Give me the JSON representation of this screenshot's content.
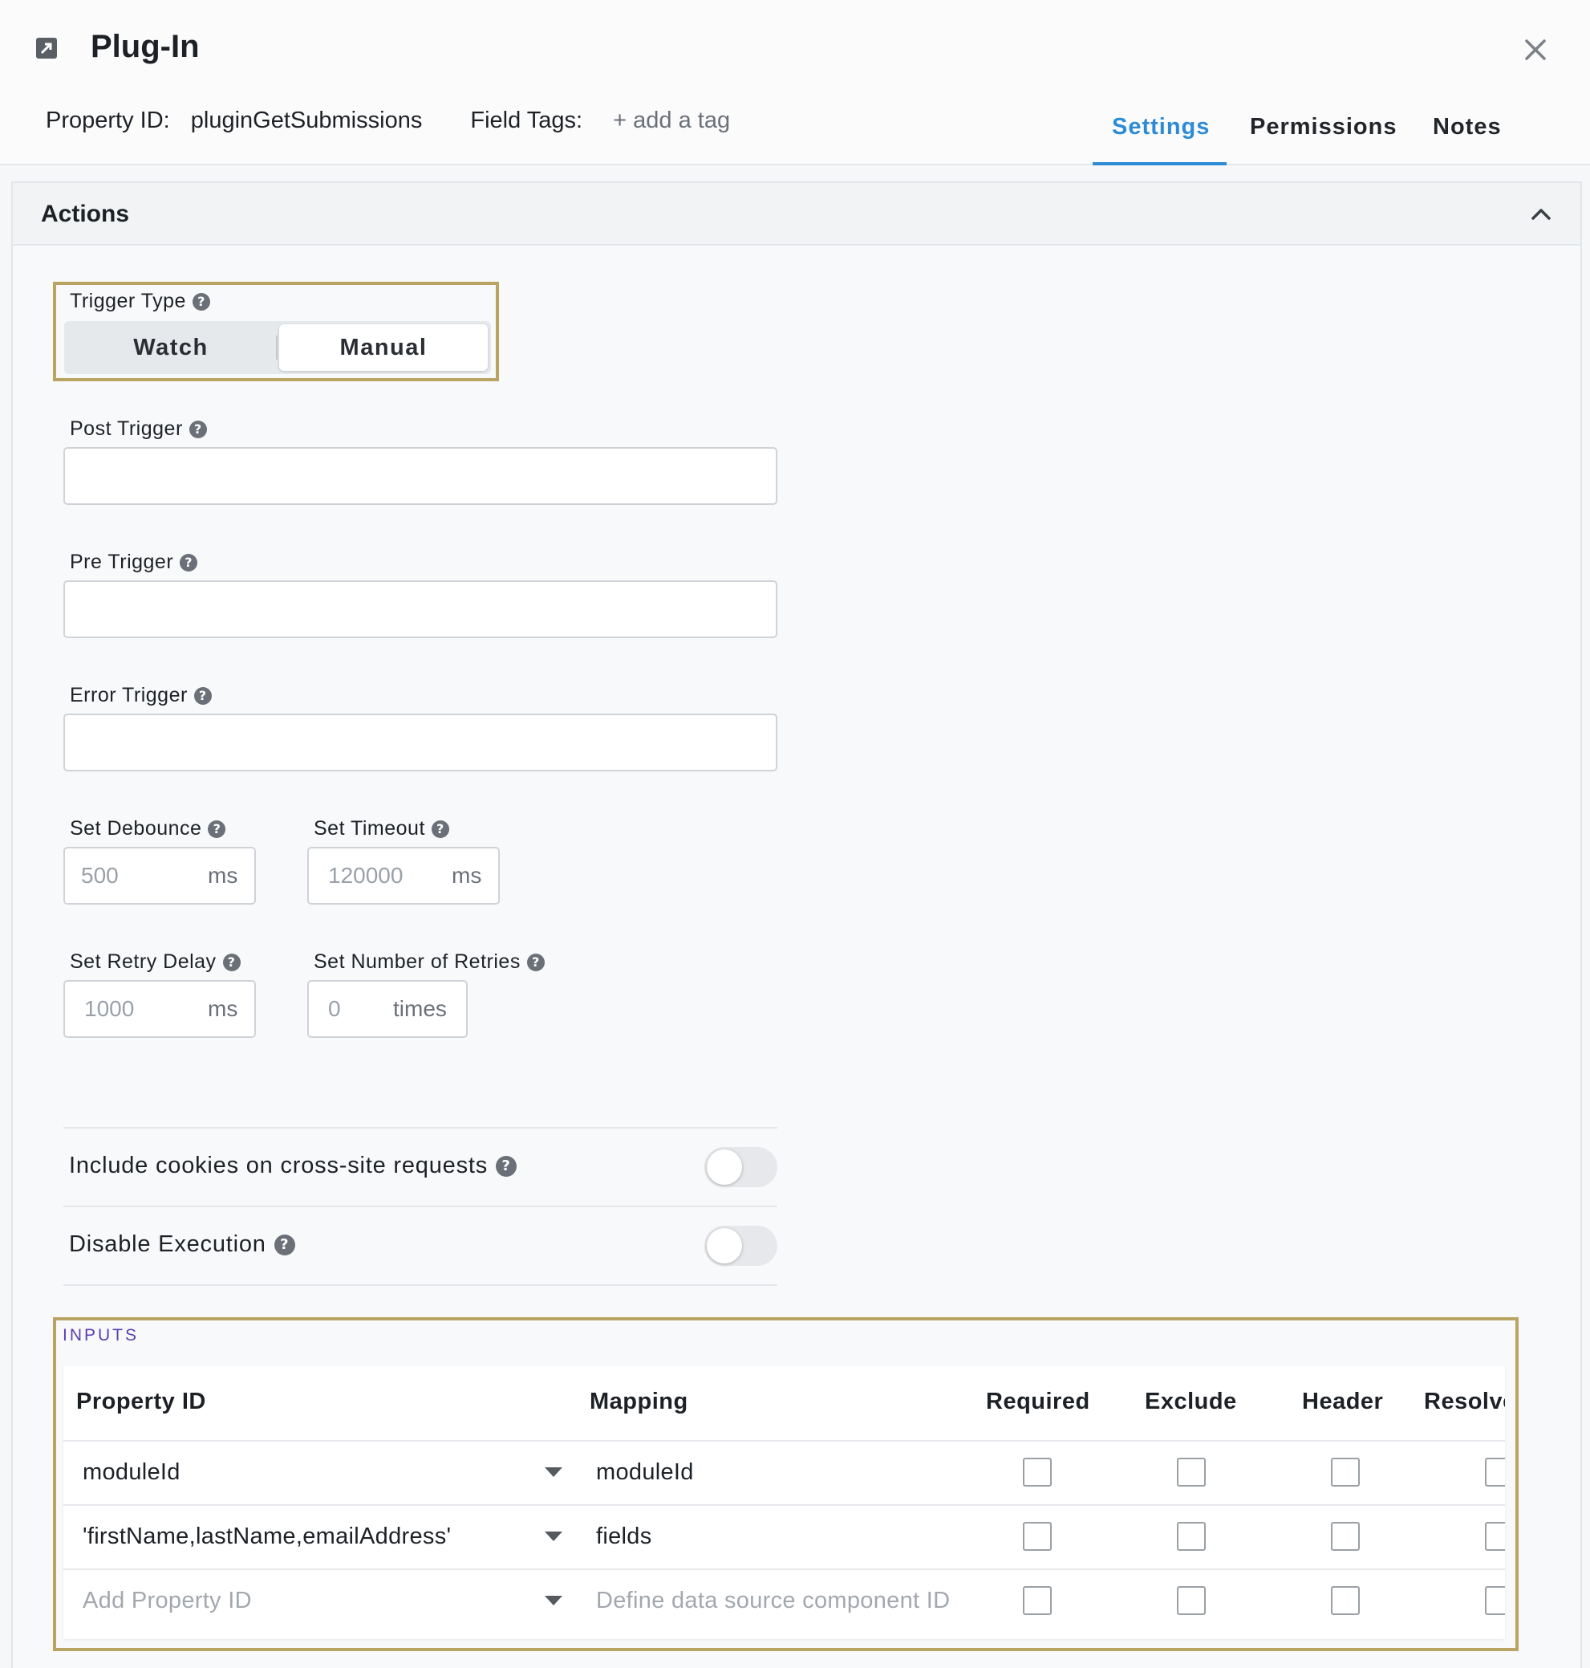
{
  "header": {
    "title": "Plug-In",
    "property_id_label": "Property ID:",
    "property_id_value": "pluginGetSubmissions",
    "field_tags_label": "Field Tags:",
    "add_tag": "+ add a tag",
    "tabs": [
      {
        "label": "Settings",
        "active": true
      },
      {
        "label": "Permissions",
        "active": false
      },
      {
        "label": "Notes",
        "active": false
      }
    ]
  },
  "actions": {
    "title": "Actions",
    "trigger_type": {
      "label": "Trigger Type",
      "options": [
        "Watch",
        "Manual"
      ],
      "selected": "Manual"
    },
    "post_trigger": {
      "label": "Post Trigger",
      "value": ""
    },
    "pre_trigger": {
      "label": "Pre Trigger",
      "value": ""
    },
    "error_trigger": {
      "label": "Error Trigger",
      "value": ""
    },
    "debounce": {
      "label": "Set Debounce",
      "placeholder": "500",
      "unit": "ms"
    },
    "timeout": {
      "label": "Set Timeout",
      "placeholder": "120000",
      "unit": "ms"
    },
    "retry_delay": {
      "label": "Set Retry Delay",
      "placeholder": "1000",
      "unit": "ms"
    },
    "retries": {
      "label": "Set Number of Retries",
      "placeholder": "0",
      "unit": "times"
    },
    "include_cookies": {
      "label": "Include cookies on cross-site requests",
      "on": false
    },
    "disable_execution": {
      "label": "Disable Execution",
      "on": false
    }
  },
  "inputs": {
    "title": "INPUTS",
    "columns": [
      "Property ID",
      "Mapping",
      "Required",
      "Exclude",
      "Header",
      "Resolve"
    ],
    "rows": [
      {
        "property_id": "moduleId",
        "mapping": "moduleId"
      },
      {
        "property_id": "'firstName,lastName,emailAddress'",
        "mapping": "fields"
      }
    ],
    "new_row": {
      "property_placeholder": "Add Property ID",
      "mapping_placeholder": "Define data source component ID"
    }
  },
  "colors": {
    "accent": "#2d8bd6",
    "highlight_border": "#b9a463",
    "inputs_title": "#5b3fb0"
  },
  "icons": [
    "external-link-icon",
    "close-icon",
    "chevron-up-icon",
    "help-icon",
    "caret-down-icon"
  ]
}
